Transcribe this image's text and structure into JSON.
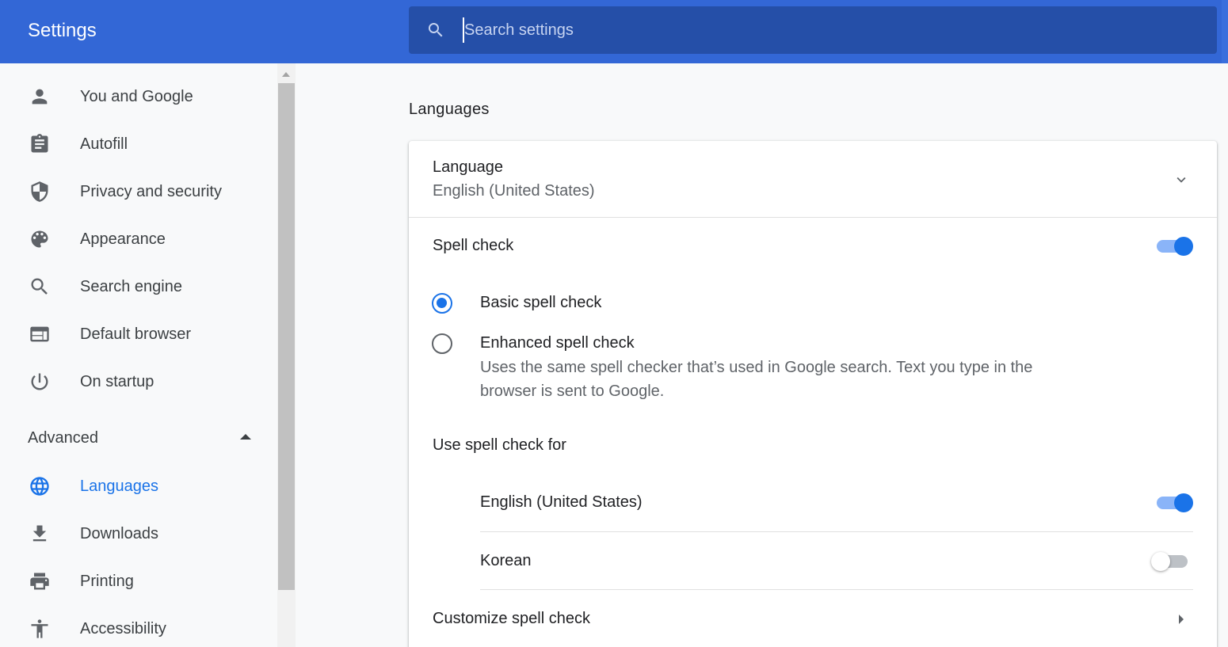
{
  "header": {
    "title": "Settings",
    "search_placeholder": "Search settings"
  },
  "sidebar": {
    "items": [
      {
        "label": "You and Google",
        "icon": "person-icon"
      },
      {
        "label": "Autofill",
        "icon": "clipboard-icon"
      },
      {
        "label": "Privacy and security",
        "icon": "shield-icon"
      },
      {
        "label": "Appearance",
        "icon": "palette-icon"
      },
      {
        "label": "Search engine",
        "icon": "search-icon"
      },
      {
        "label": "Default browser",
        "icon": "browser-window-icon"
      },
      {
        "label": "On startup",
        "icon": "power-icon"
      }
    ],
    "advanced_label": "Advanced",
    "advanced_items": [
      {
        "label": "Languages",
        "icon": "globe-icon",
        "active": true
      },
      {
        "label": "Downloads",
        "icon": "download-icon"
      },
      {
        "label": "Printing",
        "icon": "printer-icon"
      },
      {
        "label": "Accessibility",
        "icon": "accessibility-icon"
      }
    ]
  },
  "main": {
    "section_title": "Languages",
    "language": {
      "title": "Language",
      "value": "English (United States)"
    },
    "spell_check": {
      "label": "Spell check",
      "enabled": true,
      "basic_label": "Basic spell check",
      "enhanced_label": "Enhanced spell check",
      "enhanced_description_line1": "Uses the same spell checker that’s used in Google search. Text you type in the",
      "enhanced_description_line2": "browser is sent to Google.",
      "selected": "basic",
      "use_for_label": "Use spell check for",
      "languages": [
        {
          "label": "English (United States)",
          "enabled": true
        },
        {
          "label": "Korean",
          "enabled": false
        }
      ],
      "customize_label": "Customize spell check"
    }
  },
  "colors": {
    "header_blue": "#3367d6",
    "search_bg": "#254fa8",
    "accent": "#1a73e8"
  }
}
